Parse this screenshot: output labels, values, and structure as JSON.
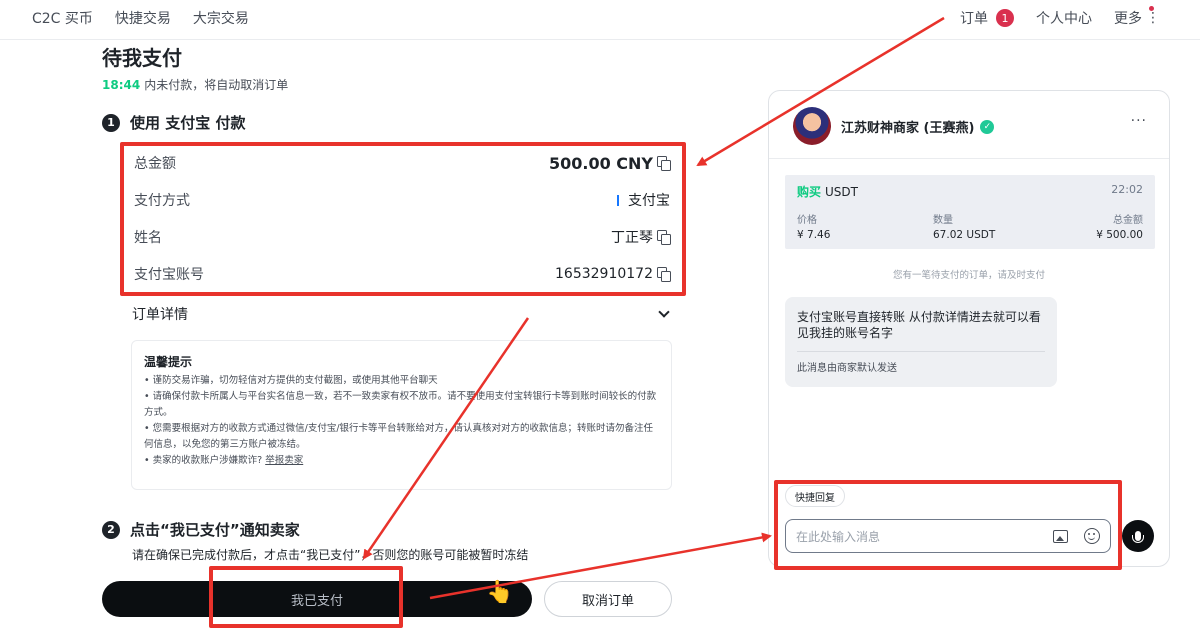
{
  "nav": {
    "left": [
      "C2C 买币",
      "快捷交易",
      "大宗交易"
    ],
    "orders_label": "订单",
    "orders_badge": "1",
    "profile_label": "个人中心",
    "more_label": "更多"
  },
  "page": {
    "title": "待我支付",
    "countdown": "18:44",
    "countdown_text": "内未付款，将自动取消订单"
  },
  "step1": {
    "num": "1",
    "title": "使用 支付宝 付款",
    "rows": [
      {
        "label": "总金额",
        "value": "500.00 CNY"
      },
      {
        "label": "支付方式",
        "value": "支付宝"
      },
      {
        "label": "姓名",
        "value": "丁正琴"
      },
      {
        "label": "支付宝账号",
        "value": "16532910172"
      }
    ],
    "order_detail_label": "订单详情"
  },
  "tips": {
    "title": "温馨提示",
    "items": [
      "• 谨防交易诈骗，切勿轻信对方提供的支付截图，或使用其他平台聊天",
      "• 请确保付款卡所属人与平台实名信息一致，若不一致卖家有权不放币。请不要使用支付宝转银行卡等到账时间较长的付款方式。",
      "• 您需要根据对方的收款方式通过微信/支付宝/银行卡等平台转账给对方，请认真核对对方的收款信息；转账时请勿备注任何信息，以免您的第三方账户被冻结。",
      "• 卖家的收款账户涉嫌欺诈?"
    ],
    "report_link": "举报卖家"
  },
  "step2": {
    "num": "2",
    "title": "点击“我已支付”通知卖家",
    "desc": "请在确保已完成付款后，才点击“我已支付”，否则您的账号可能被暂时冻结"
  },
  "buttons": {
    "paid": "我已支付",
    "cancel": "取消订单"
  },
  "chat": {
    "seller_name": "江苏财神商家 (王赛燕)",
    "menu": "···",
    "order": {
      "side": "购买",
      "asset": "USDT",
      "time": "22:02",
      "price_label": "价格",
      "price": "¥ 7.46",
      "qty_label": "数量",
      "qty": "67.02 USDT",
      "total_label": "总金额",
      "total": "¥ 500.00"
    },
    "pending_note": "您有一笔待支付的订单，请及时支付",
    "message": "支付宝账号直接转账 从付款详情进去就可以看见我挂的账号名字",
    "auto_note": "此消息由商家默认发送",
    "quick_reply": "快捷回复",
    "input_placeholder": "在此处输入消息"
  },
  "colors": {
    "accent_green": "#0ecb81",
    "badge_red": "#d9304e",
    "annotation_red": "#e8322b",
    "primary_black": "#0b0e11"
  }
}
